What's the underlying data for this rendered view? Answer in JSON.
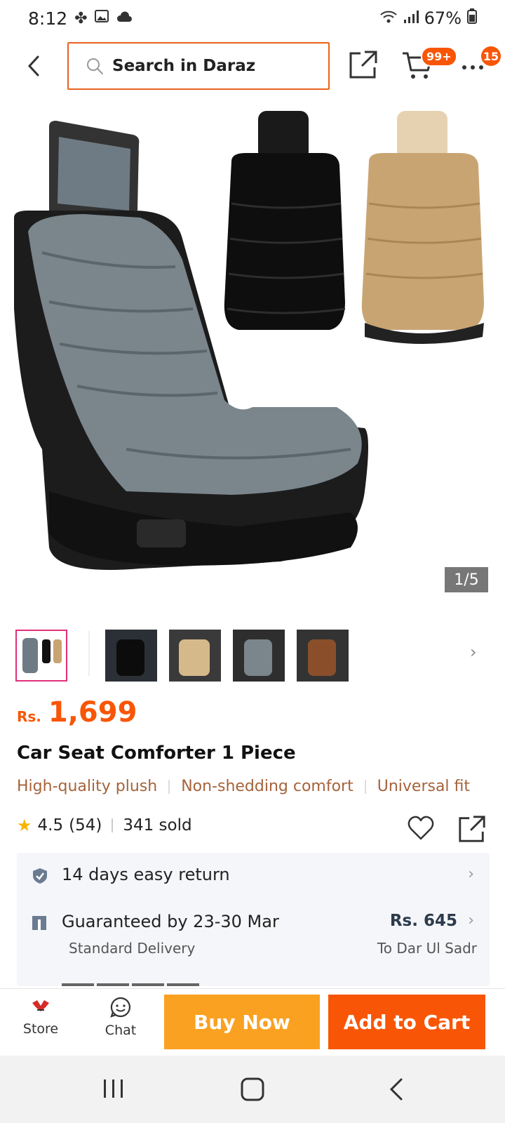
{
  "status_bar": {
    "time": "8:12",
    "battery": "67%"
  },
  "search": {
    "text": "Search in Daraz"
  },
  "header": {
    "cart_badge": "99+",
    "more_badge": "15"
  },
  "gallery": {
    "counter": "1/5",
    "thumbnail_count": 5,
    "active_index": 0
  },
  "product": {
    "currency": "Rs.",
    "price": "1,699",
    "title": "Car Seat Comforter 1 Piece",
    "tags": [
      "High-quality plush",
      "Non-shedding comfort",
      "Universal fit"
    ],
    "rating": "4.5",
    "rating_count": "(54)",
    "sold": "341 sold"
  },
  "services": {
    "return": "14 days easy return",
    "delivery_title": "Guaranteed by 23-30 Mar",
    "delivery_type": "Standard Delivery",
    "delivery_fee": "Rs. 645",
    "delivery_location": "To Dar Ul Sadr"
  },
  "actions": {
    "store_label": "Store",
    "chat_label": "Chat",
    "buy_now": "Buy Now",
    "add_to_cart": "Add to Cart"
  },
  "colors": {
    "accent": "#f85606",
    "buy_now": "#fba121",
    "tag_text": "#a5633b",
    "star": "#f8b400"
  }
}
